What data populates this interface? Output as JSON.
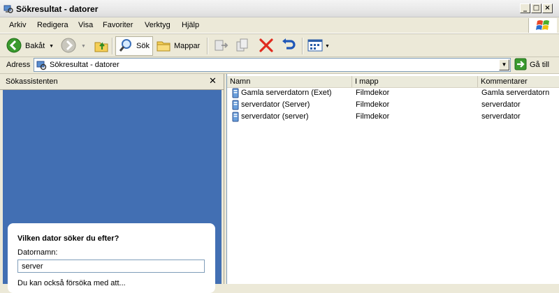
{
  "window": {
    "title": "Sökresultat - datorer"
  },
  "menu": [
    "Arkiv",
    "Redigera",
    "Visa",
    "Favoriter",
    "Verktyg",
    "Hjälp"
  ],
  "toolbar": {
    "back_label": "Bakåt",
    "search_label": "Sök",
    "folders_label": "Mappar"
  },
  "address": {
    "label": "Adress",
    "value": "Sökresultat - datorer",
    "go_label": "Gå till"
  },
  "side_panel": {
    "title": "Sökassistenten",
    "close_glyph": "✕",
    "heading": "Vilken dator söker du efter?",
    "field_label": "Datornamn:",
    "field_value": "server",
    "hint": "Du kan också försöka med att..."
  },
  "results": {
    "columns": [
      "Namn",
      "I mapp",
      "Kommentarer"
    ],
    "rows": [
      {
        "name": "Gamla serverdatorn (Exet)",
        "folder": "Filmdekor",
        "comment": "Gamla serverdatorn"
      },
      {
        "name": "serverdator (Server)",
        "folder": "Filmdekor",
        "comment": "serverdator"
      },
      {
        "name": "serverdator (server)",
        "folder": "Filmdekor",
        "comment": "serverdator"
      }
    ]
  },
  "colors": {
    "panel_blue": "#426fb3",
    "chrome": "#ece9d8",
    "accent_green": "#3a9a2e"
  }
}
